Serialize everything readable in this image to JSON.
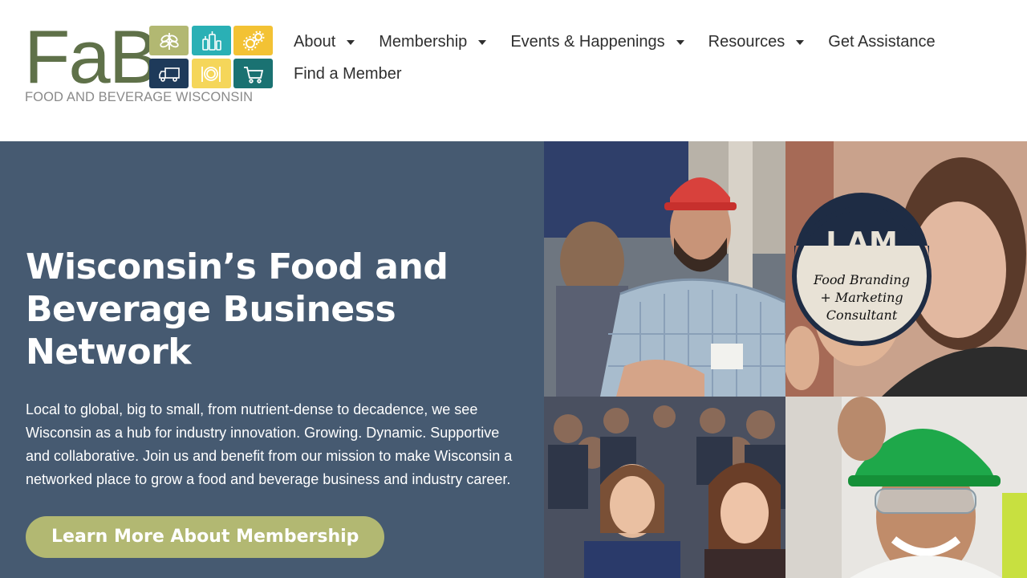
{
  "brand": {
    "logo_text": "FaB",
    "tagline": "FOOD AND BEVERAGE WISCONSIN"
  },
  "nav": {
    "items": [
      {
        "label": "About",
        "has_dropdown": true
      },
      {
        "label": "Membership",
        "has_dropdown": true
      },
      {
        "label": "Events & Happenings",
        "has_dropdown": true
      },
      {
        "label": "Resources",
        "has_dropdown": true
      },
      {
        "label": "Get Assistance",
        "has_dropdown": false
      },
      {
        "label": "Find a Member",
        "has_dropdown": false
      }
    ]
  },
  "hero": {
    "title": "Wisconsin’s Food and Beverage Business Network",
    "body": "Local to global, big to small, from nutrient-dense to decadence, we see Wisconsin as a hub for industry innovation. Growing. Dynamic. Supportive and collaborative. Join us and benefit from our mission to make Wisconsin a networked place to grow a food and beverage business and industry career.",
    "cta_label": "Learn More About Membership"
  },
  "photos": {
    "badge_heading": "I AM",
    "badge_text": "Food Branding + Marketing Consultant"
  },
  "colors": {
    "brand_green": "#5f7149",
    "hero_bg": "#465a71",
    "cta_bg": "#b2b872",
    "tile_olive": "#b2b872",
    "tile_teal": "#2ab0b5",
    "tile_yellow": "#f3c234",
    "tile_navy": "#1e3a5a",
    "tile_lightyellow": "#f5d65a",
    "tile_darkteal": "#1a7272"
  },
  "icons": [
    "wheat-icon",
    "bottles-icon",
    "gears-icon",
    "truck-icon",
    "plate-icon",
    "cart-icon",
    "dropdown-caret-icon"
  ]
}
